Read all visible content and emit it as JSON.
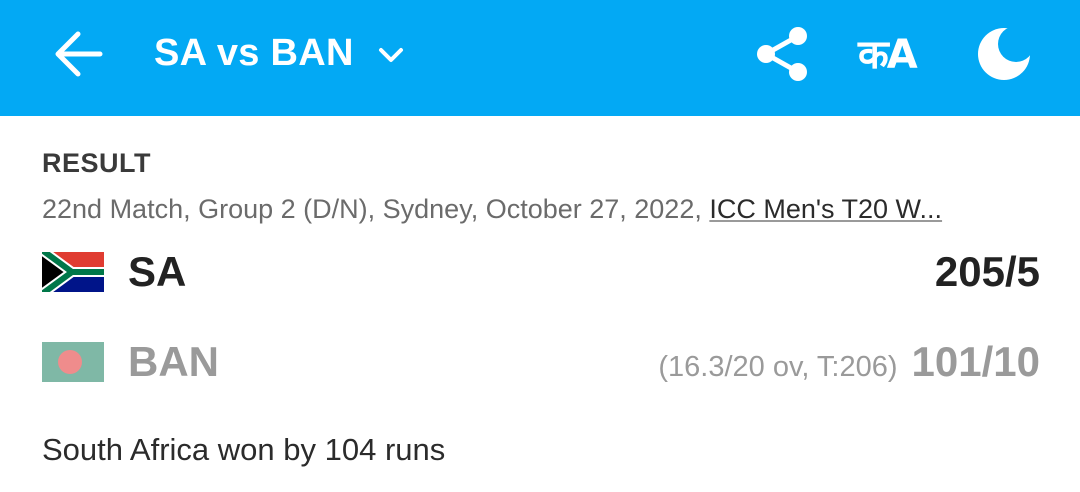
{
  "header": {
    "title": "SA vs BAN",
    "lang_label": "कA",
    "icons": [
      "back-arrow-icon",
      "chevron-down-icon",
      "share-icon",
      "moon-icon"
    ],
    "background_color": "#03a9f4"
  },
  "match": {
    "status": "RESULT",
    "info": "22nd Match, Group 2 (D/N), Sydney, October 27, 2022, ",
    "series": "ICC Men's T20 W...",
    "teams": [
      {
        "name": "SA",
        "overs": "",
        "score": "205/5",
        "flag": "south-africa-flag"
      },
      {
        "name": "BAN",
        "overs": "(16.3/20 ov, T:206)",
        "score": "101/10",
        "flag": "bangladesh-flag"
      }
    ],
    "result": "South Africa won by 104 runs"
  }
}
